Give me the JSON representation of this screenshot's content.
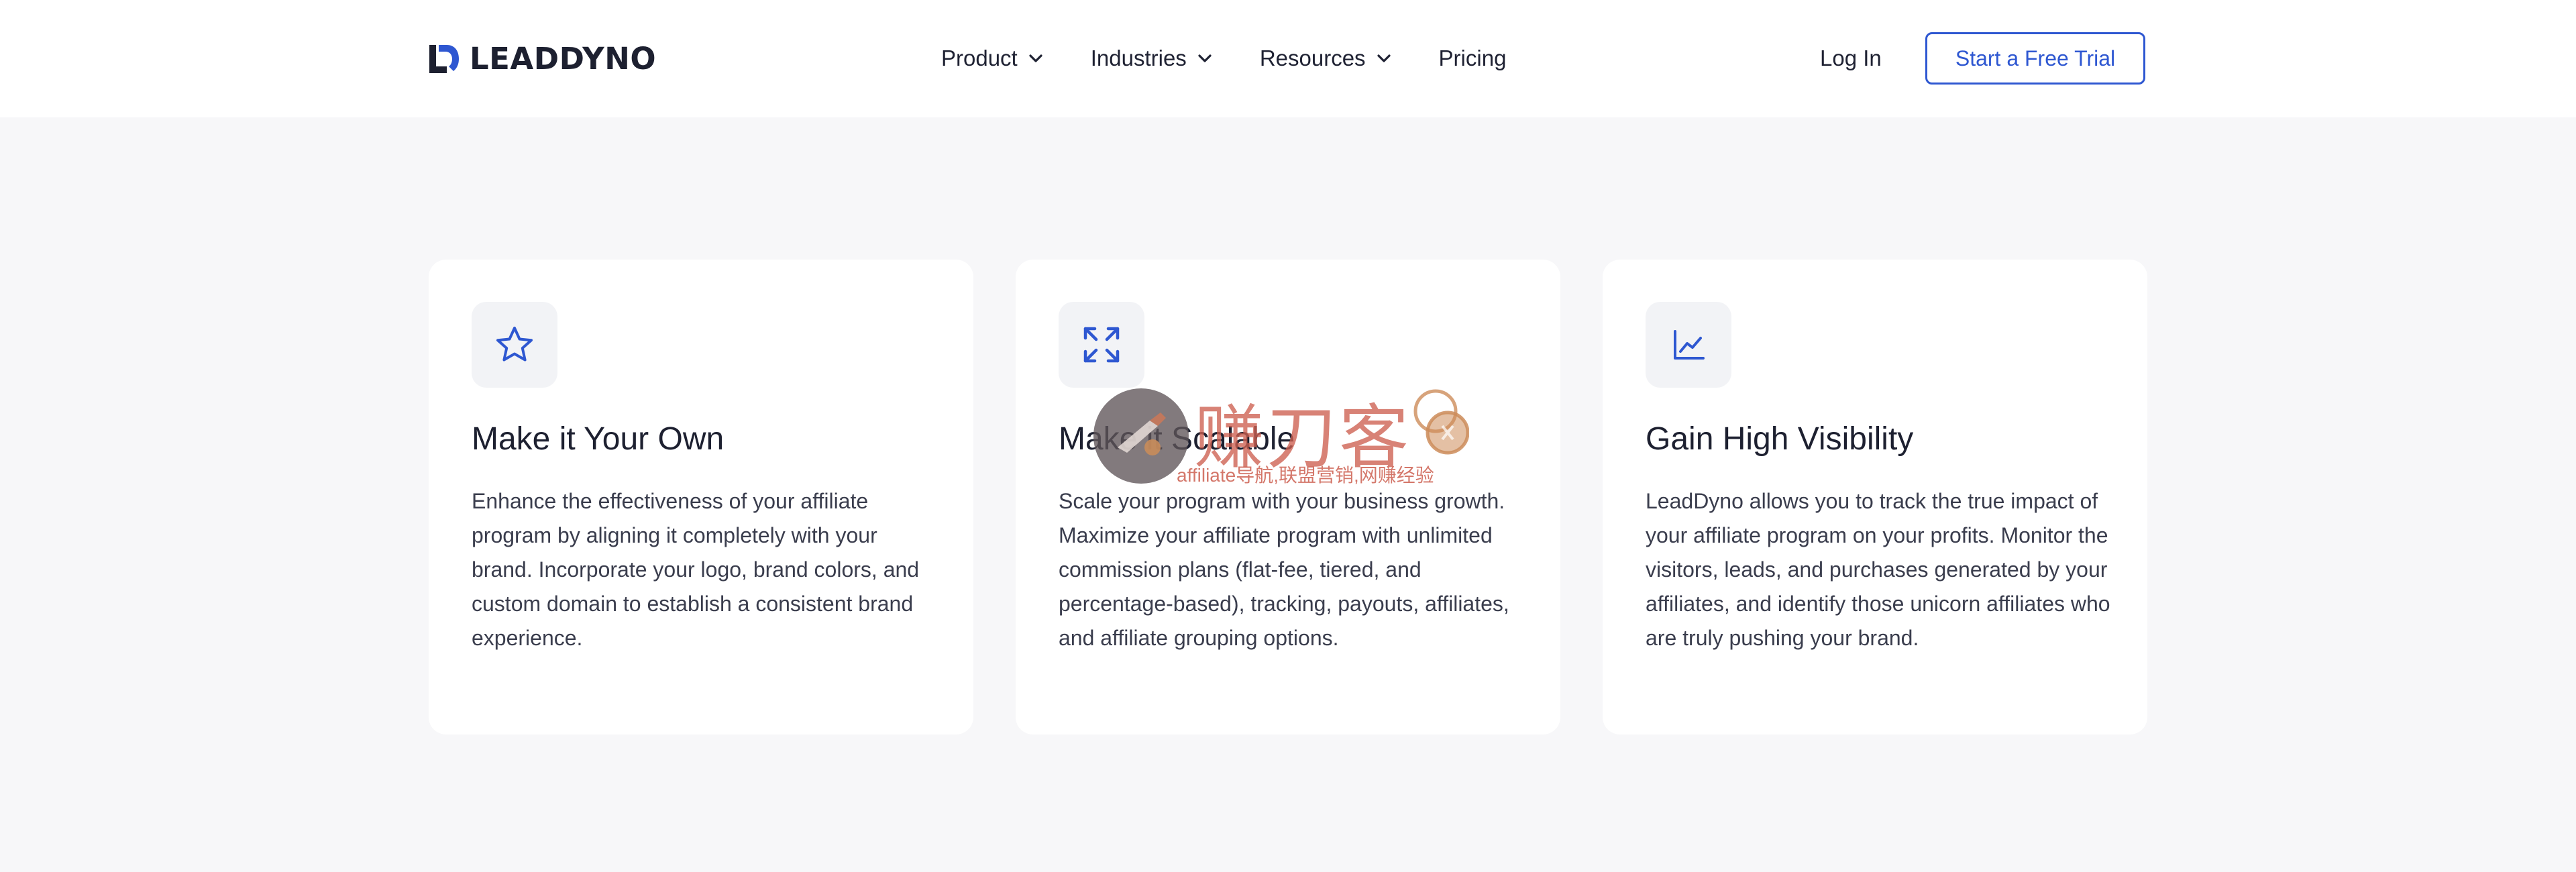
{
  "header": {
    "logo_text": "LEADDYNO",
    "nav": [
      {
        "label": "Product",
        "has_dropdown": true
      },
      {
        "label": "Industries",
        "has_dropdown": true
      },
      {
        "label": "Resources",
        "has_dropdown": true
      },
      {
        "label": "Pricing",
        "has_dropdown": false
      }
    ],
    "login_label": "Log In",
    "cta_label": "Start a Free Trial"
  },
  "features": [
    {
      "icon": "star-icon",
      "title": "Make it Your Own",
      "body": "Enhance the effectiveness of your affiliate program by aligning it completely with your brand. Incorporate your logo, brand colors, and custom domain to establish a consistent brand experience."
    },
    {
      "icon": "expand-arrows-icon",
      "title": "Make it Scalable",
      "body": "Scale your program with your business growth. Maximize your affiliate program with unlimited commission plans (flat-fee, tiered, and percentage-based), tracking, payouts, affiliates, and affiliate grouping options."
    },
    {
      "icon": "line-chart-icon",
      "title": "Gain High Visibility",
      "body": "LeadDyno allows you to track the true impact of your affiliate program on your profits. Monitor the visitors, leads, and purchases generated by your affiliates, and identify those unicorn affiliates who are truly pushing your brand."
    }
  ],
  "watermark": {
    "title": "赚刀客",
    "subtitle": "affiliate导航,联盟营销,网赚经验"
  },
  "colors": {
    "brand_blue": "#2e57d1",
    "text_dark": "#1d2030",
    "text_body": "#3a3d4d",
    "page_bg": "#f7f7f9",
    "card_bg": "#ffffff",
    "icon_bg": "#f2f3f6"
  }
}
